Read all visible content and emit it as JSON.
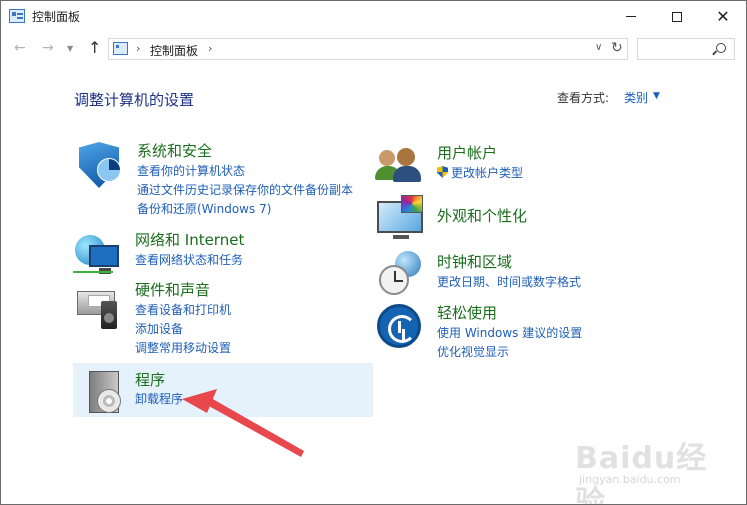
{
  "window": {
    "title": "控制面板"
  },
  "address": {
    "path": "控制面板",
    "search_placeholder": ""
  },
  "header": {
    "title": "调整计算机的设置",
    "view_by_label": "查看方式:",
    "view_by_value": "类别"
  },
  "categories": {
    "system_security": {
      "title": "系统和安全",
      "links": [
        "查看你的计算机状态",
        "通过文件历史记录保存你的文件备份副本",
        "备份和还原(Windows 7)"
      ]
    },
    "network": {
      "title": "网络和 Internet",
      "links": [
        "查看网络状态和任务"
      ]
    },
    "hardware": {
      "title": "硬件和声音",
      "links": [
        "查看设备和打印机",
        "添加设备",
        "调整常用移动设置"
      ]
    },
    "programs": {
      "title": "程序",
      "links": [
        "卸载程序"
      ]
    },
    "user_accounts": {
      "title": "用户帐户",
      "links": [
        "更改帐户类型"
      ]
    },
    "appearance": {
      "title": "外观和个性化",
      "links": []
    },
    "clock_region": {
      "title": "时钟和区域",
      "links": [
        "更改日期、时间或数字格式"
      ]
    },
    "ease_access": {
      "title": "轻松使用",
      "links": [
        "使用 Windows 建议的设置",
        "优化视觉显示"
      ]
    }
  },
  "watermark": {
    "brand": "Baidu经验",
    "url": "jingyan.baidu.com"
  },
  "colors": {
    "link": "#1f5fb8",
    "category_title": "#1a6e1c",
    "heading": "#1e3287",
    "highlight": "#e5f1fb",
    "annotation_arrow": "#e8474b"
  }
}
